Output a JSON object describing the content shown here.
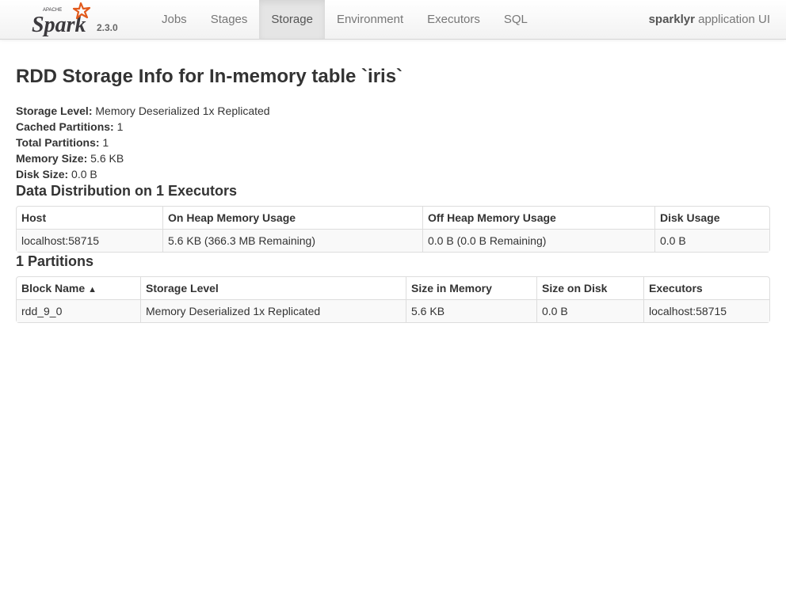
{
  "brand": {
    "logo_small_text": "APACHE",
    "logo_text": "Spark",
    "version": "2.3.0"
  },
  "nav": {
    "tabs": [
      {
        "label": "Jobs",
        "active": false
      },
      {
        "label": "Stages",
        "active": false
      },
      {
        "label": "Storage",
        "active": true
      },
      {
        "label": "Environment",
        "active": false
      },
      {
        "label": "Executors",
        "active": false
      },
      {
        "label": "SQL",
        "active": false
      }
    ],
    "app_name_bold": "sparklyr",
    "app_name_rest": " application UI"
  },
  "page": {
    "title": "RDD Storage Info for In-memory table `iris`",
    "summary": [
      {
        "label": "Storage Level:",
        "value": " Memory Deserialized 1x Replicated"
      },
      {
        "label": "Cached Partitions:",
        "value": " 1"
      },
      {
        "label": "Total Partitions:",
        "value": " 1"
      },
      {
        "label": "Memory Size:",
        "value": " 5.6 KB"
      },
      {
        "label": "Disk Size:",
        "value": " 0.0 B"
      }
    ]
  },
  "distribution": {
    "heading": "Data Distribution on 1 Executors",
    "columns": [
      "Host",
      "On Heap Memory Usage",
      "Off Heap Memory Usage",
      "Disk Usage"
    ],
    "rows": [
      [
        "localhost:58715",
        "5.6 KB (366.3 MB Remaining)",
        "0.0 B (0.0 B Remaining)",
        "0.0 B"
      ]
    ]
  },
  "partitions": {
    "heading": "1 Partitions",
    "columns": [
      "Block Name",
      "Storage Level",
      "Size in Memory",
      "Size on Disk",
      "Executors"
    ],
    "sort_indicator": "▲",
    "rows": [
      [
        "rdd_9_0",
        "Memory Deserialized 1x Replicated",
        "5.6 KB",
        "0.0 B",
        "localhost:58715"
      ]
    ]
  },
  "colors": {
    "logo_orange": "#e25a1c",
    "logo_text": "#3c3a3e",
    "active_tab_bg": "#e5e5e5",
    "table_border": "#dddddd"
  }
}
